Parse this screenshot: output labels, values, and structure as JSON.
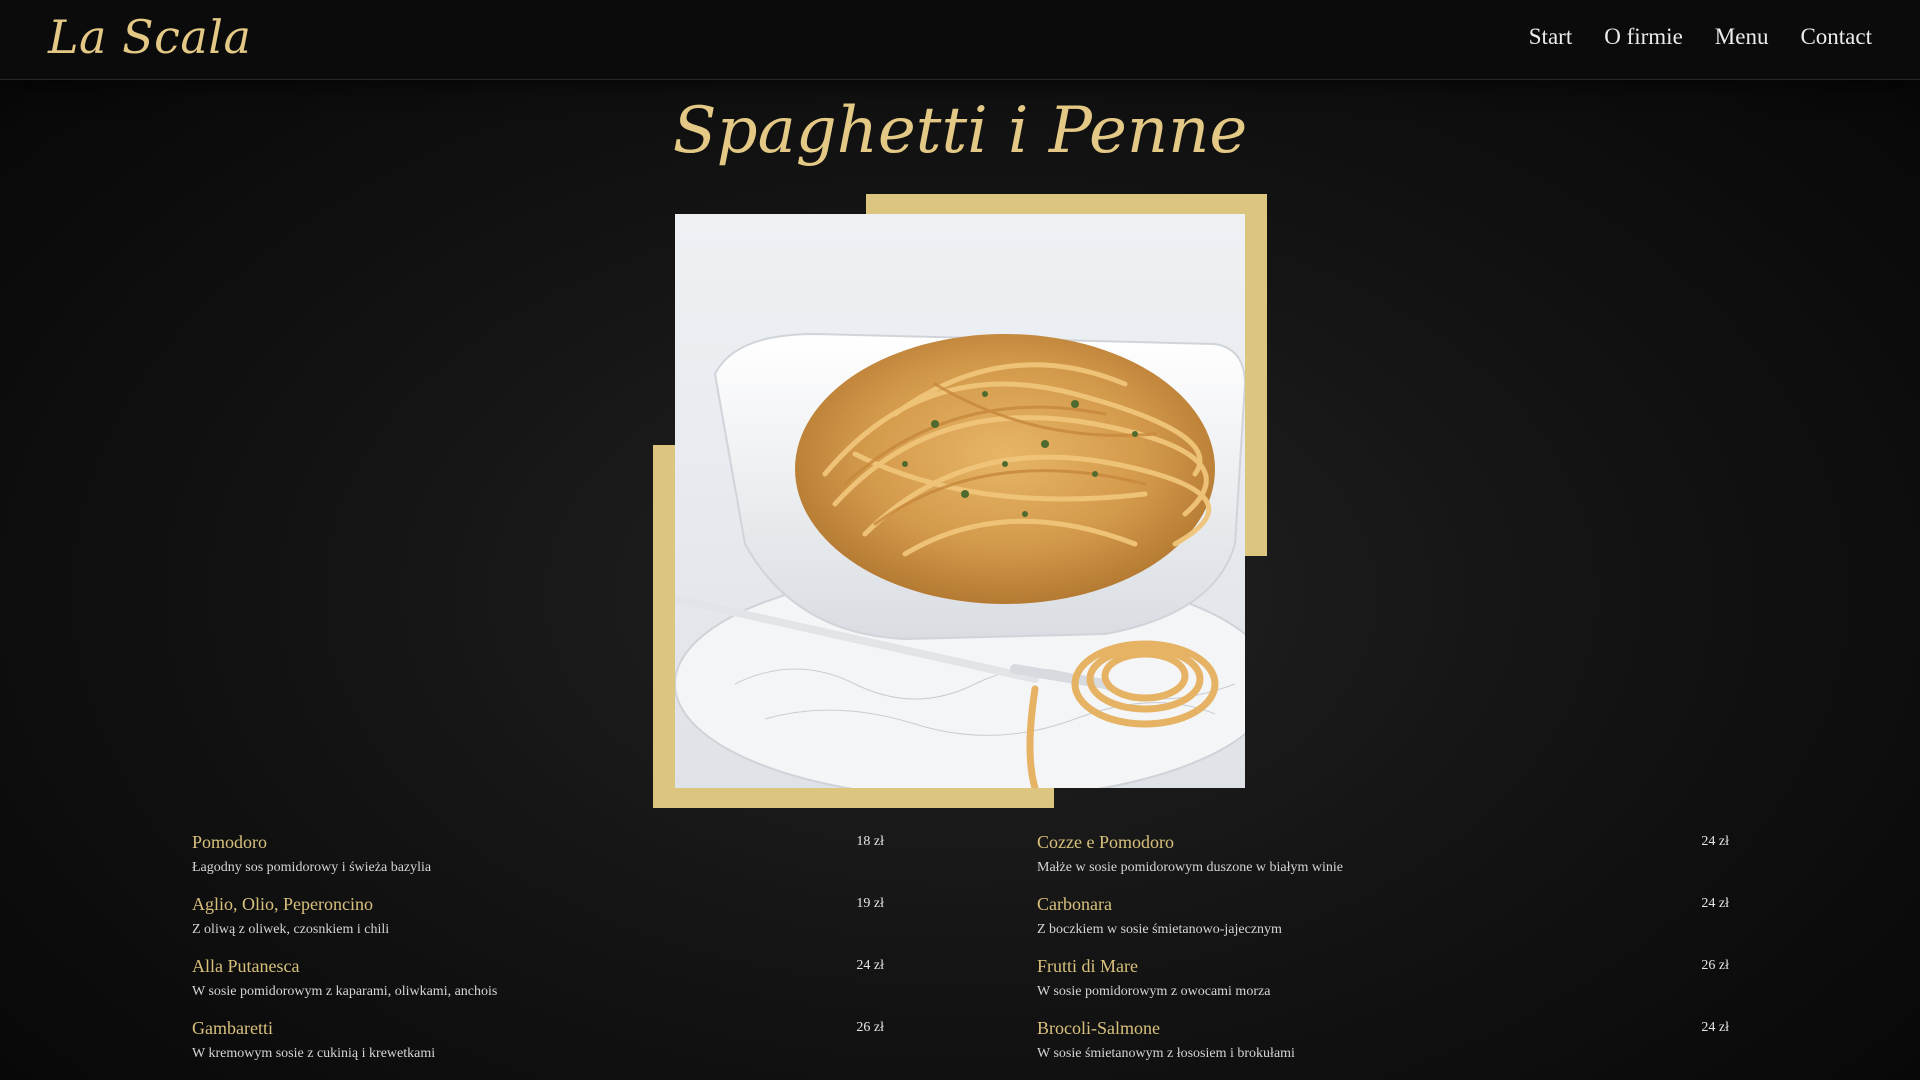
{
  "header": {
    "logo": "La Scala",
    "nav": [
      "Start",
      "O firmie",
      "Menu",
      "Contact"
    ]
  },
  "section": {
    "title": "Spaghetti i Penne"
  },
  "colors": {
    "accent_gold": "#e3c985",
    "frame_gold": "#dcc57f",
    "background": "#0a0a0a"
  },
  "menu": {
    "left": [
      {
        "name": "Pomodoro",
        "desc": "Łagodny sos pomidorowy i świeża bazylia",
        "price": "18 zł"
      },
      {
        "name": "Aglio, Olio, Peperoncino",
        "desc": "Z oliwą z oliwek, czosnkiem i chili",
        "price": "19 zł"
      },
      {
        "name": "Alla Putanesca",
        "desc": "W sosie pomidorowym z kaparami, oliwkami, anchois",
        "price": "24 zł"
      },
      {
        "name": "Gambaretti",
        "desc": "W kremowym sosie z cukinią i krewetkami",
        "price": "26 zł"
      }
    ],
    "right": [
      {
        "name": "Cozze e Pomodoro",
        "desc": "Małże w sosie pomidorowym duszone w białym winie",
        "price": "24 zł"
      },
      {
        "name": "Carbonara",
        "desc": "Z boczkiem w sosie śmietanowo-jajecznym",
        "price": "24 zł"
      },
      {
        "name": "Frutti di Mare",
        "desc": "W sosie pomidorowym z owocami morza",
        "price": "26 zł"
      },
      {
        "name": "Brocoli-Salmone",
        "desc": "W sosie śmietanowym z łososiem i brokułami",
        "price": "24 zł"
      }
    ]
  }
}
